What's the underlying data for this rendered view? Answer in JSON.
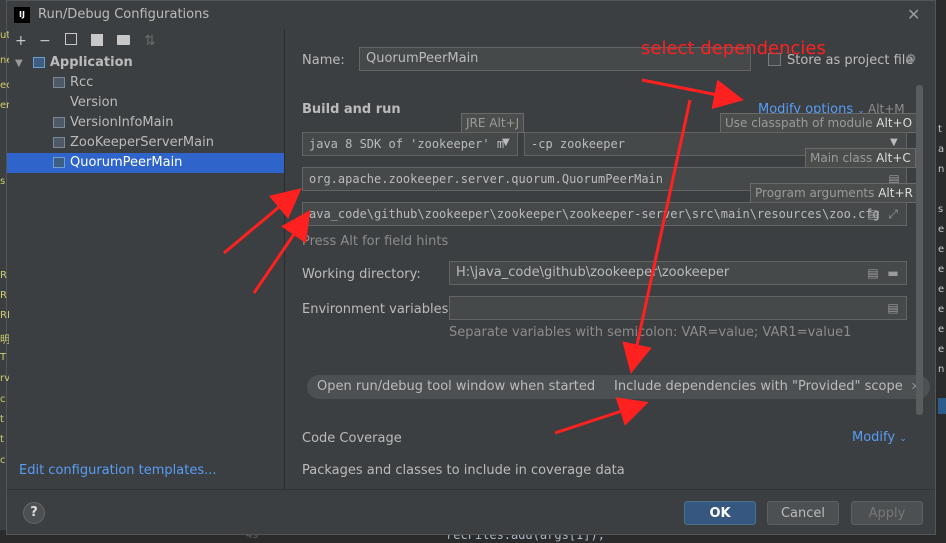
{
  "window": {
    "title": "Run/Debug Configurations",
    "logo_text": "IJ"
  },
  "toolbar": {
    "add": "+",
    "remove": "−",
    "copy": "⧉",
    "save": "💾",
    "folder": "📁",
    "sort": "⇅"
  },
  "tree": {
    "root": "Application",
    "items": [
      "Rcc",
      "Version",
      "VersionInfoMain",
      "ZooKeeperServerMain",
      "QuorumPeerMain"
    ],
    "selected_index": 4
  },
  "left_footer": {
    "edit_templates": "Edit configuration templates..."
  },
  "form": {
    "name_label": "Name:",
    "name_value": "QuorumPeerMain",
    "store_label": "Store as project file",
    "build_and_run": "Build and run",
    "modify_options": "Modify options",
    "modify_shortcut": "Alt+M",
    "jre_tooltip": "JRE Alt+J",
    "java_select": "java 8  SDK of 'zookeeper' m",
    "cp_select": "-cp  zookeeper",
    "main_class": "org.apache.zookeeper.server.quorum.QuorumPeerMain",
    "program_args": "ava_code\\github\\zookeeper\\zookeeper\\zookeeper-server\\src\\main\\resources\\zoo.cfg",
    "field_hint": "Press Alt for field hints",
    "working_dir_label": "Working directory:",
    "working_dir_value": "H:\\java_code\\github\\zookeeper\\zookeeper",
    "env_label": "Environment variables:",
    "env_value": "",
    "env_hint": "Separate variables with semicolon: VAR=value; VAR1=value1",
    "tooltip_classpath": "Use classpath of module",
    "tooltip_classpath_key": "Alt+O",
    "tooltip_main": "Main class",
    "tooltip_main_key": "Alt+C",
    "tooltip_args": "Program arguments",
    "tooltip_args_key": "Alt+R",
    "chip_open_window": "Open run/debug tool window when started",
    "chip_provided": "Include dependencies with \"Provided\" scope",
    "code_coverage": "Code Coverage",
    "modify": "Modify",
    "packages_label": "Packages and classes to include in coverage data"
  },
  "buttons": {
    "ok": "OK",
    "cancel": "Cancel",
    "apply": "Apply",
    "help": "?"
  },
  "annotation": {
    "text": "select dependencies",
    "color": "#ff2020"
  },
  "ide_bg": {
    "left_lines": [
      "ut",
      "ne",
      "ec",
      "er",
      "s",
      "R",
      "R",
      "RI",
      "明",
      "T",
      "rv",
      "c",
      "t",
      "t",
      "c"
    ],
    "right_lines": [
      "t",
      "a",
      "n",
      "s",
      "e",
      "e",
      "e",
      "e",
      "e",
      "e",
      "e",
      "n"
    ],
    "line_number": "49",
    "code_snippet": "recFiles.add(args[1]);"
  }
}
